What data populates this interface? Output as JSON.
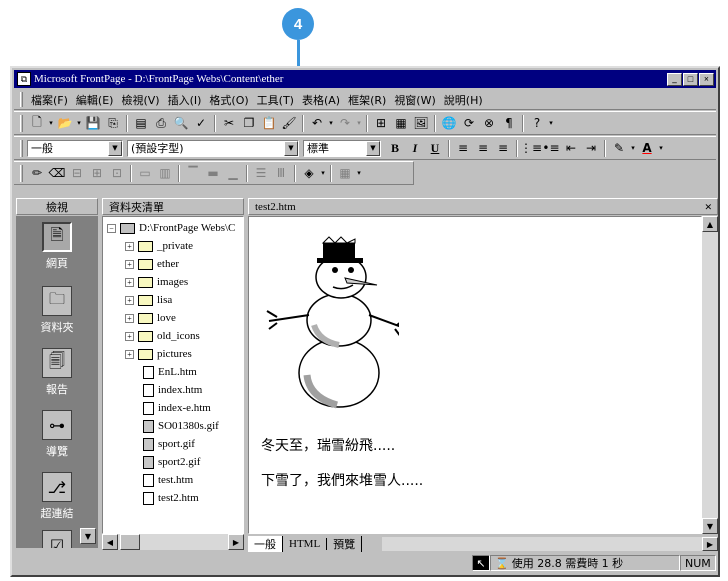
{
  "callout": {
    "number": "4",
    "color": "#3b96dd"
  },
  "window": {
    "title": "Microsoft FrontPage - D:\\FrontPage Webs\\Content\\ether",
    "controls": [
      "minimize-icon",
      "maximize-icon",
      "close-icon"
    ]
  },
  "menu": [
    "檔案(F)",
    "編輯(E)",
    "檢視(V)",
    "插入(I)",
    "格式(O)",
    "工具(T)",
    "表格(A)",
    "框架(R)",
    "視窗(W)",
    "說明(H)"
  ],
  "format_toolbar": {
    "style": "一般",
    "font": "(預設字型)",
    "size": "標準",
    "bold": "B",
    "italic": "I",
    "underline": "U"
  },
  "views_panel": {
    "header": "檢視",
    "items": [
      {
        "label": "網頁",
        "icon": "page-icon"
      },
      {
        "label": "資料夾",
        "icon": "folder-icon"
      },
      {
        "label": "報告",
        "icon": "report-icon"
      },
      {
        "label": "導覽",
        "icon": "navigation-icon"
      },
      {
        "label": "超連結",
        "icon": "hyperlink-icon"
      }
    ]
  },
  "folder_panel": {
    "header": "資料夾清單",
    "root": "D:\\FrontPage Webs\\C",
    "folders": [
      "_private",
      "ether",
      "images",
      "lisa",
      "love",
      "old_icons",
      "pictures"
    ],
    "files": [
      "EnL.htm",
      "index.htm",
      "index-e.htm",
      "SO01380s.gif",
      "sport.gif",
      "sport2.gif",
      "test.htm",
      "test2.htm"
    ]
  },
  "editor": {
    "tab_title": "test2.htm",
    "close": "×",
    "line1": "冬天至，瑞雪紛飛.....",
    "line2": "下雪了，我們來堆雪人.....",
    "tabs": [
      "一般",
      "HTML",
      "預覽"
    ]
  },
  "statusbar": {
    "download": "使用 28.8 需費時 1 秒",
    "num": "NUM"
  }
}
